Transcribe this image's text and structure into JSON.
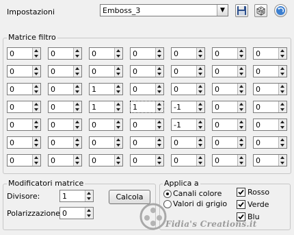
{
  "header": {
    "preset_label": "Impostazioni",
    "preset_value": "Emboss_3"
  },
  "matrix": {
    "group_label": "Matrice filtro",
    "rows": [
      [
        "0",
        "0",
        "0",
        "0",
        "0",
        "0",
        "0"
      ],
      [
        "0",
        "0",
        "0",
        "0",
        "0",
        "0",
        "0"
      ],
      [
        "0",
        "0",
        "1",
        "0",
        "0",
        "0",
        "0"
      ],
      [
        "0",
        "0",
        "1",
        "1",
        "-1",
        "0",
        "0"
      ],
      [
        "0",
        "0",
        "0",
        "0",
        "-1",
        "0",
        "0"
      ],
      [
        "0",
        "0",
        "0",
        "0",
        "0",
        "0",
        "0"
      ],
      [
        "0",
        "0",
        "0",
        "0",
        "0",
        "0",
        "0"
      ]
    ]
  },
  "modifiers": {
    "group_label": "Modificatori matrice",
    "divisor_label": "Divisore:",
    "divisor_value": "1",
    "bias_label": "Polarizzazione:",
    "bias_value": "0",
    "calc_button": "Calcola"
  },
  "apply": {
    "group_label": "Applica a",
    "radio_color": "Canali colore",
    "radio_gray": "Valori di grigio",
    "selected": "Canali colore",
    "chk_red": "Rosso",
    "chk_green": "Verde",
    "chk_blue": "Blu",
    "red_checked": true,
    "green_checked": true,
    "blue_checked": true
  },
  "watermark": {
    "text": "Fidia's Creations.it"
  }
}
